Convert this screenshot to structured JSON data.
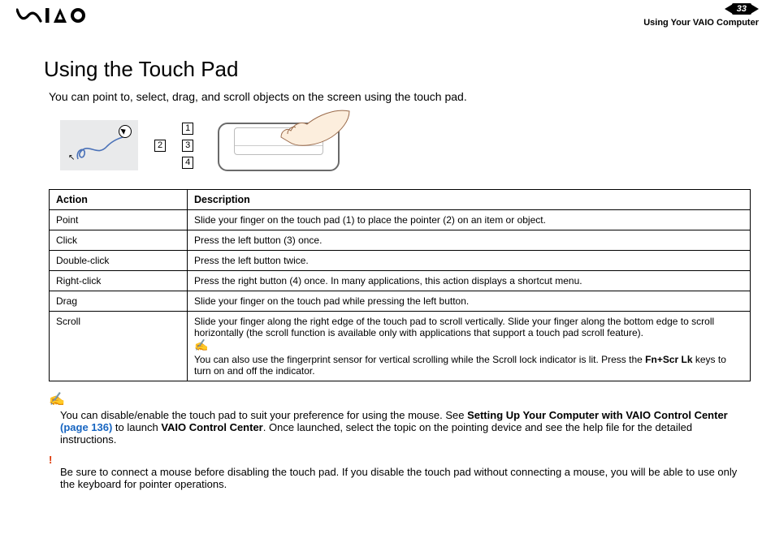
{
  "header": {
    "page_number": "33",
    "section": "Using Your VAIO Computer"
  },
  "title": "Using the Touch Pad",
  "intro": "You can point to, select, drag, and scroll objects on the screen using the touch pad.",
  "callouts": {
    "c1": "1",
    "c2": "2",
    "c3": "3",
    "c4": "4"
  },
  "table": {
    "headers": {
      "action": "Action",
      "description": "Description"
    },
    "rows": [
      {
        "action": "Point",
        "description": "Slide your finger on the touch pad (1) to place the pointer (2) on an item or object."
      },
      {
        "action": "Click",
        "description": "Press the left button (3) once."
      },
      {
        "action": "Double-click",
        "description": "Press the left button twice."
      },
      {
        "action": "Right-click",
        "description": "Press the right button (4) once. In many applications, this action displays a shortcut menu."
      },
      {
        "action": "Drag",
        "description": "Slide your finger on the touch pad while pressing the left button."
      },
      {
        "action": "Scroll",
        "description": "Slide your finger along the right edge of the touch pad to scroll vertically. Slide your finger along the bottom edge to scroll horizontally (the scroll function is available only with applications that support a touch pad scroll feature).",
        "note_pre": "You can also use the fingerprint sensor for vertical scrolling while the Scroll lock indicator is lit. Press the ",
        "note_bold": "Fn+Scr Lk",
        "note_post": " keys to turn on and off the indicator."
      }
    ]
  },
  "footnote1": {
    "pre": "You can disable/enable the touch pad to suit your preference for using the mouse. See ",
    "bold1": "Setting Up Your Computer with VAIO Control Center ",
    "link": "(page 136)",
    "mid": " to launch ",
    "bold2": "VAIO Control Center",
    "post": ". Once launched, select the topic on the pointing device and see the help file for the detailed instructions."
  },
  "footnote2": "Be sure to connect a mouse before disabling the touch pad. If you disable the touch pad without connecting a mouse, you will be able to use only the keyboard for pointer operations."
}
